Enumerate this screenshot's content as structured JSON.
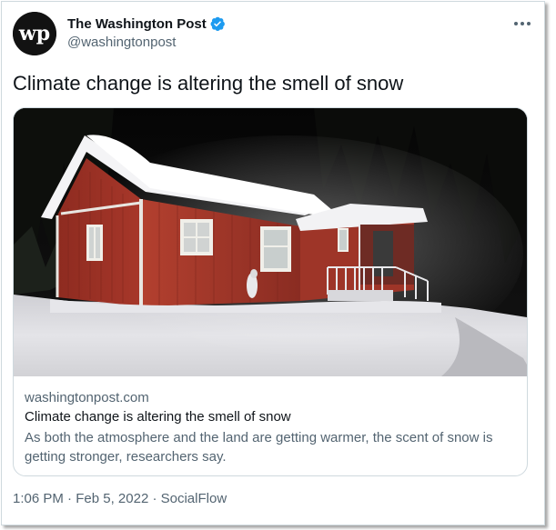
{
  "author": {
    "display_name": "The Washington Post",
    "handle": "@washingtonpost",
    "verified": true,
    "avatar_logo": "wp",
    "avatar_bg": "#111111",
    "verified_color": "#1d9bf0"
  },
  "tweet": {
    "text": "Climate change is altering the smell of snow"
  },
  "card": {
    "domain": "washingtonpost.com",
    "title": "Climate change is altering the smell of snow",
    "description": "As both the atmosphere and the land are getting warmer, the scent of snow is getting stronger, researchers say."
  },
  "meta": {
    "time": "1:06 PM",
    "separator1": " · ",
    "date": "Feb 5, 2022",
    "separator2": " · ",
    "source": "SocialFlow"
  },
  "icons": {
    "more": "more-icon",
    "verified": "verified-badge-icon"
  }
}
